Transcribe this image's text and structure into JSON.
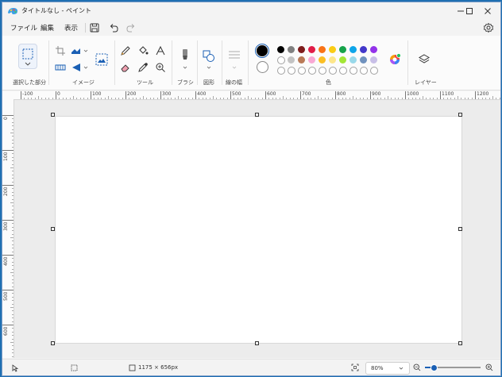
{
  "window": {
    "title": "タイトルなし - ペイント"
  },
  "menu": {
    "file": "ファイル",
    "edit": "編集",
    "view": "表示"
  },
  "ribbon": {
    "selection_label": "選択した部分",
    "image_label": "イメージ",
    "tools_label": "ツール",
    "brush_label": "ブラシ",
    "shapes_label": "図形",
    "stroke_label": "線の幅",
    "colors_label": "色",
    "layers_label": "レイヤー"
  },
  "colors": {
    "primary": "#000000",
    "secondary": "#ffffff",
    "row1": [
      "#000000",
      "#808080",
      "#7f1d1d",
      "#e11d48",
      "#f97316",
      "#facc15",
      "#16a34a",
      "#0ea5e9",
      "#4338ca",
      "#9333ea"
    ],
    "row2": [
      "#ffffff",
      "#c3c3c3",
      "#b97a57",
      "#f9a8d4",
      "#fbbf24",
      "#fde68a",
      "#a3e635",
      "#99d9ea",
      "#7092be",
      "#c8bfe7"
    ]
  },
  "ruler": {
    "h_labels": [
      "-100",
      "0",
      "100",
      "200",
      "300",
      "400",
      "500",
      "600",
      "700",
      "800",
      "900",
      "1000",
      "1100",
      "1200"
    ],
    "v_labels": [
      "0",
      "100",
      "200",
      "300",
      "400",
      "500",
      "600"
    ]
  },
  "status": {
    "canvas_size": "1175 × 656px",
    "zoom": "80%"
  }
}
